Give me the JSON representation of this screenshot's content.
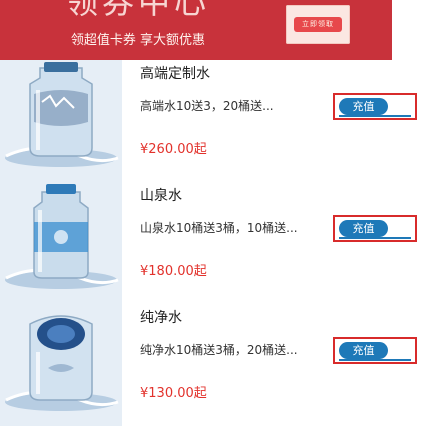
{
  "banner": {
    "title": "领券中心",
    "subtitle": "领超值卡券 享大额优惠",
    "receive_button": "立即领取"
  },
  "products": [
    {
      "name": "高端定制水",
      "description": "高端水10送3，20桶送...",
      "price": "¥260.00起",
      "button": "充值"
    },
    {
      "name": "山泉水",
      "description": "山泉水10桶送3桶，10桶送...",
      "price": "¥180.00起",
      "button": "充值"
    },
    {
      "name": "纯净水",
      "description": "纯净水10桶送3桶，20桶送...",
      "price": "¥130.00起",
      "button": "充值"
    }
  ],
  "colors": {
    "banner": "#c8323b",
    "price": "#e2322c",
    "button_border": "#d82b2b",
    "button_fill": "#1e79b8"
  }
}
